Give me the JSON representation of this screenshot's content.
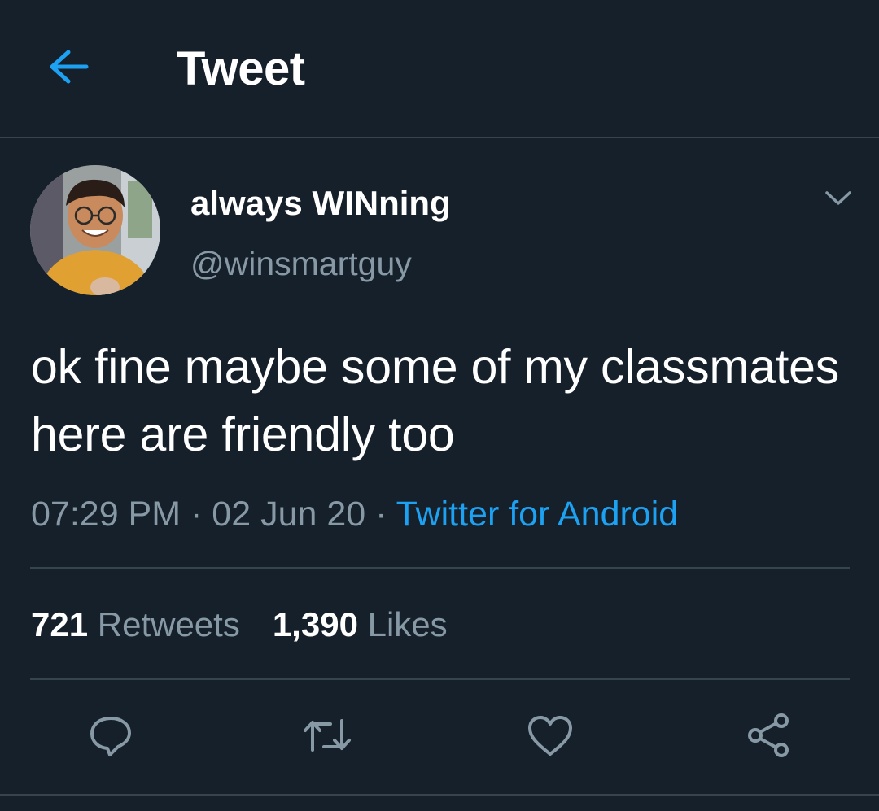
{
  "header": {
    "back_icon": "arrow-left-icon",
    "title": "Tweet",
    "accent_color": "#1da1f2"
  },
  "author": {
    "display_name": "always WINning",
    "handle": "@winsmartguy",
    "caret_icon": "chevron-down-icon"
  },
  "tweet": {
    "text": "ok fine maybe some of my classmates here are friendly too",
    "time": "07:29 PM",
    "date": "02 Jun 20",
    "separator": "·",
    "source": "Twitter for Android"
  },
  "stats": {
    "retweets_count": "721",
    "retweets_label": "Retweets",
    "likes_count": "1,390",
    "likes_label": "Likes"
  },
  "actions": [
    "reply-icon",
    "retweet-icon",
    "like-icon",
    "share-icon"
  ],
  "colors": {
    "background": "#15202b",
    "divider": "#38444d",
    "secondary_text": "#8899a6",
    "link": "#1da1f2"
  }
}
